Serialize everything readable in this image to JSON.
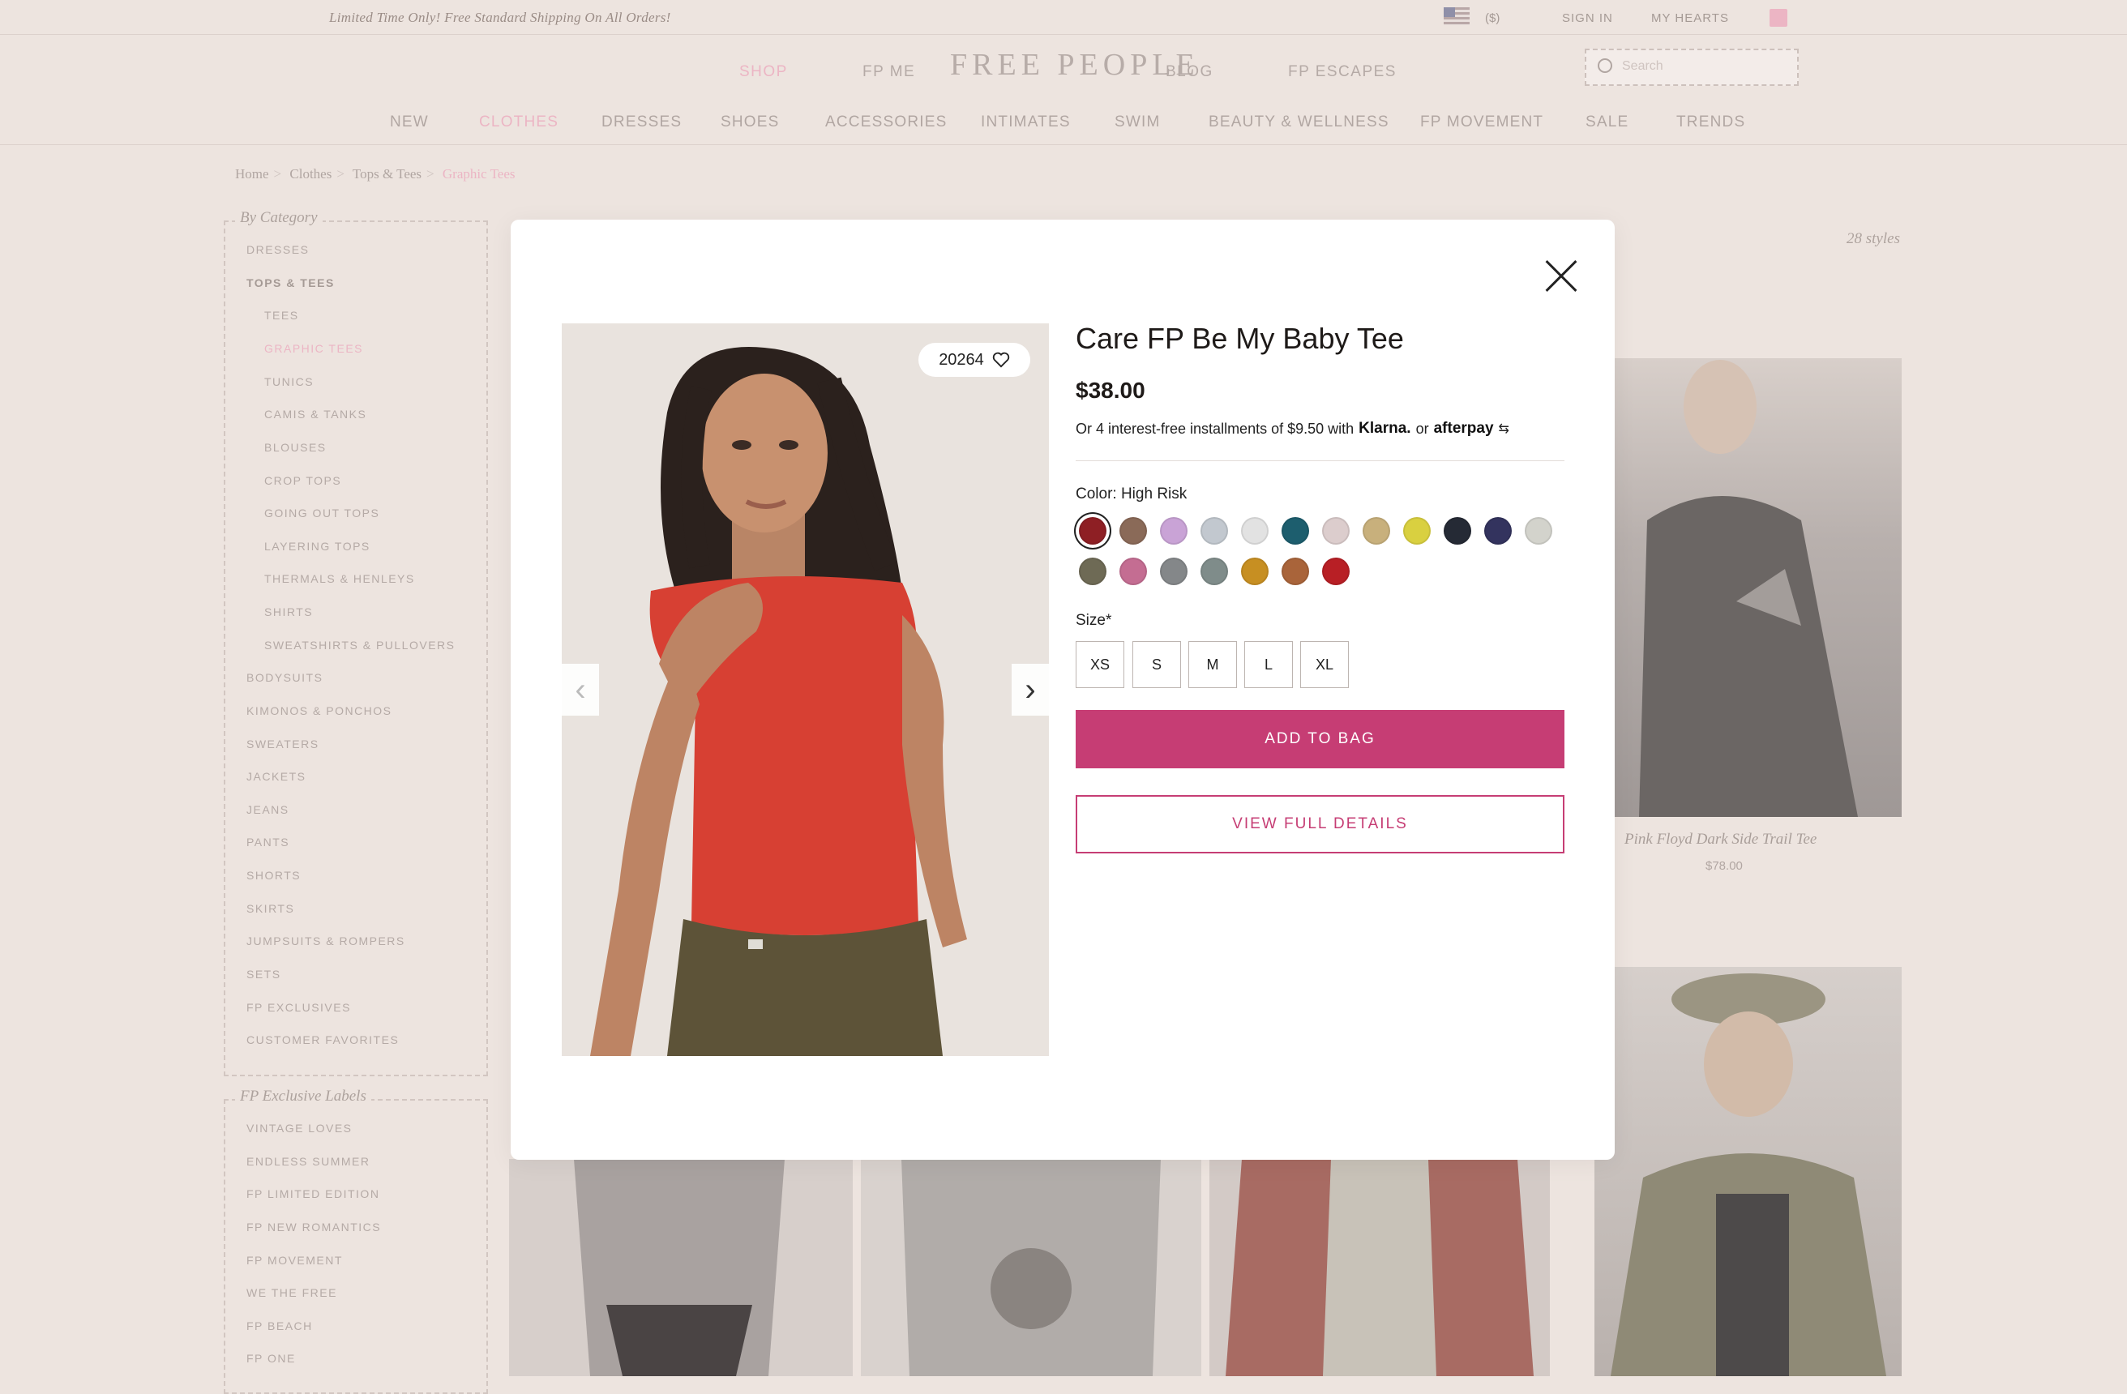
{
  "header": {
    "promo": "Limited Time Only! Free Standard Shipping On All Orders!",
    "currency": "($)",
    "sign_in": "SIGN IN",
    "my_hearts": "MY HEARTS",
    "logo": "FREE PEOPLE",
    "nav_top": [
      "SHOP",
      "FP ME",
      "BLOG",
      "FP ESCAPES"
    ],
    "search_placeholder": "Search"
  },
  "category_nav": [
    "NEW",
    "CLOTHES",
    "DRESSES",
    "SHOES",
    "ACCESSORIES",
    "INTIMATES",
    "SWIM",
    "BEAUTY & WELLNESS",
    "FP MOVEMENT",
    "SALE",
    "TRENDS"
  ],
  "breadcrumb": {
    "items": [
      "Home",
      "Clothes",
      "Tops & Tees"
    ],
    "current": "Graphic Tees"
  },
  "sidebar": {
    "heading": "By Category",
    "items": [
      "DRESSES",
      "TOPS & TEES",
      "TEES",
      "GRAPHIC TEES",
      "TUNICS",
      "CAMIS & TANKS",
      "BLOUSES",
      "CROP TOPS",
      "GOING OUT TOPS",
      "LAYERING TOPS",
      "THERMALS & HENLEYS",
      "SHIRTS",
      "SWEATSHIRTS & PULLOVERS",
      "BODYSUITS",
      "KIMONOS & PONCHOS",
      "SWEATERS",
      "JACKETS",
      "JEANS",
      "PANTS",
      "SHORTS",
      "SKIRTS",
      "JUMPSUITS & ROMPERS",
      "SETS",
      "FP EXCLUSIVES",
      "CUSTOMER FAVORITES"
    ],
    "labels_heading": "FP Exclusive Labels",
    "labels": [
      "VINTAGE LOVES",
      "ENDLESS SUMMER",
      "FP LIMITED EDITION",
      "FP NEW ROMANTICS",
      "FP MOVEMENT",
      "WE THE FREE",
      "FP BEACH",
      "FP ONE"
    ]
  },
  "listing": {
    "styles_count": "28 styles",
    "visible_product": {
      "name": "Pink Floyd Dark Side Trail Tee",
      "price": "$78.00"
    }
  },
  "modal": {
    "hearts_count": "20264",
    "title": "Care FP Be My Baby Tee",
    "price": "$38.00",
    "installments_text": "Or 4 interest-free installments of $9.50 with",
    "klarna": "Klarna.",
    "or": "or",
    "afterpay": "afterpay",
    "color_label": "Color: High Risk",
    "swatches": [
      "#8e1f24",
      "#8a6a58",
      "#c9a3d6",
      "#c2c8cf",
      "#e2e2e2",
      "#1d5e6e",
      "#dccdcd",
      "#c8b07c",
      "#d9d040",
      "#252a35",
      "#33335e",
      "#d3d3cc",
      "#6e6a55",
      "#c46d92",
      "#848789",
      "#7f8c8a",
      "#c78f22",
      "#a9643a",
      "#b81f25"
    ],
    "size_label": "Size*",
    "sizes": [
      "XS",
      "S",
      "M",
      "L",
      "XL"
    ],
    "add_to_bag": "ADD TO BAG",
    "view_full_details": "VIEW FULL DETAILS"
  },
  "colors": {
    "accent": "#c63d74",
    "pink_link": "#ecb5c4"
  }
}
